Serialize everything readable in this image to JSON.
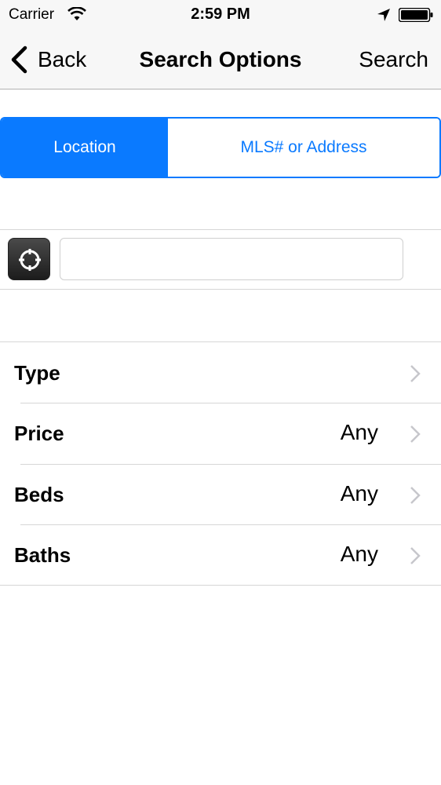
{
  "status_bar": {
    "carrier": "Carrier",
    "time": "2:59 PM"
  },
  "nav": {
    "back_label": "Back",
    "title": "Search Options",
    "action_label": "Search"
  },
  "segments": [
    {
      "label": "Location",
      "selected": true
    },
    {
      "label": "MLS# or Address",
      "selected": false
    }
  ],
  "location": {
    "input_value": "",
    "placeholder": ""
  },
  "options": [
    {
      "label": "Type",
      "value": ""
    },
    {
      "label": "Price",
      "value": "Any"
    },
    {
      "label": "Beds",
      "value": "Any"
    },
    {
      "label": "Baths",
      "value": "Any"
    }
  ],
  "colors": {
    "accent": "#0a7aff",
    "separator": "#d6d6d6",
    "chevron": "#c7c7cc"
  }
}
